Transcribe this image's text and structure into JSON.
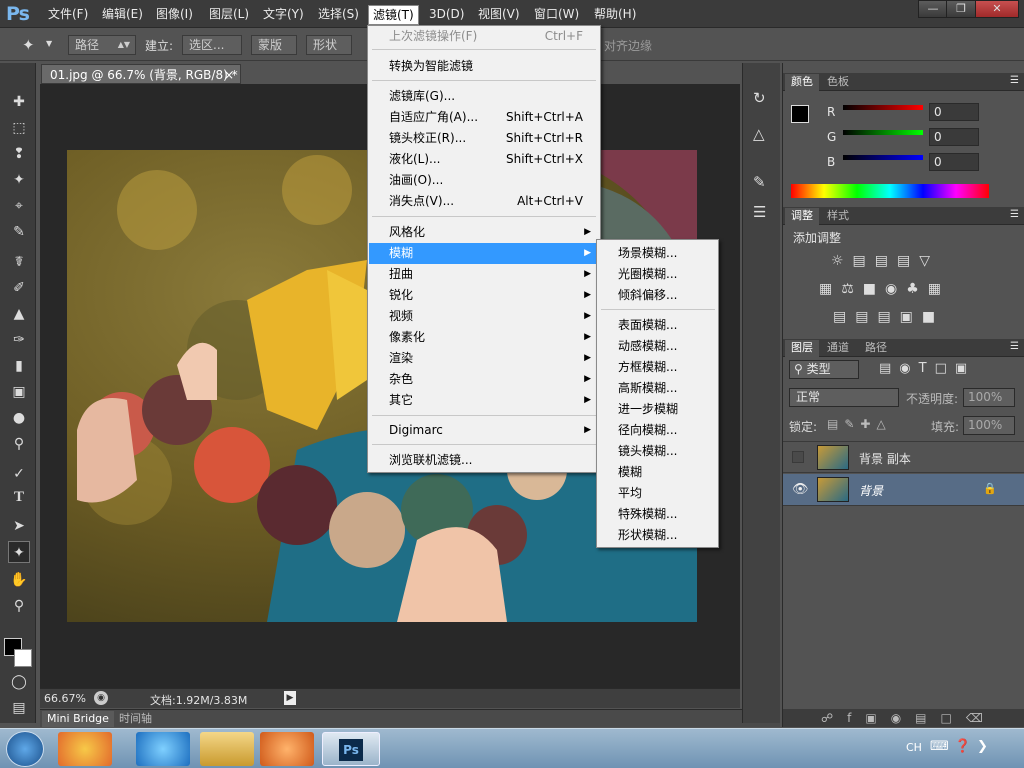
{
  "app": {
    "logo": "Ps"
  },
  "menubar": {
    "items": [
      "文件(F)",
      "编辑(E)",
      "图像(I)",
      "图层(L)",
      "文字(Y)",
      "选择(S)",
      "滤镜(T)",
      "3D(D)",
      "视图(V)",
      "窗口(W)",
      "帮助(H)"
    ],
    "active": "滤镜(T)",
    "window_controls": [
      "minimize-icon",
      "restore-icon",
      "close-icon"
    ]
  },
  "options_bar": {
    "mode_value": "路径",
    "build_label": "建立:",
    "selection_btn": "选区...",
    "mask_btn": "蒙版",
    "shape_btn": "形状",
    "align_edges": "对齐边缘"
  },
  "document": {
    "tab_title": "01.jpg @ 66.7% (背景, RGB/8) *",
    "zoom": "66.67%",
    "doc_info": "文档:1.92M/3.83M"
  },
  "bottom_tabs": [
    "Mini Bridge",
    "时间轴"
  ],
  "filter_menu": {
    "items": [
      {
        "label": "上次滤镜操作(F)",
        "shortcut": "Ctrl+F",
        "disabled": true
      },
      {
        "label": "转换为智能滤镜"
      },
      {
        "label": "滤镜库(G)..."
      },
      {
        "label": "自适应广角(A)...",
        "shortcut": "Shift+Ctrl+A"
      },
      {
        "label": "镜头校正(R)...",
        "shortcut": "Shift+Ctrl+R"
      },
      {
        "label": "液化(L)...",
        "shortcut": "Shift+Ctrl+X"
      },
      {
        "label": "油画(O)..."
      },
      {
        "label": "消失点(V)...",
        "shortcut": "Alt+Ctrl+V"
      },
      {
        "label": "风格化",
        "submenu": true
      },
      {
        "label": "模糊",
        "submenu": true,
        "highlight": true
      },
      {
        "label": "扭曲",
        "submenu": true
      },
      {
        "label": "锐化",
        "submenu": true
      },
      {
        "label": "视频",
        "submenu": true
      },
      {
        "label": "像素化",
        "submenu": true
      },
      {
        "label": "渲染",
        "submenu": true
      },
      {
        "label": "杂色",
        "submenu": true
      },
      {
        "label": "其它",
        "submenu": true
      },
      {
        "label": "Digimarc",
        "submenu": true
      },
      {
        "label": "浏览联机滤镜..."
      }
    ]
  },
  "blur_submenu": {
    "items": [
      "场景模糊...",
      "光圈模糊...",
      "倾斜偏移...",
      "表面模糊...",
      "动感模糊...",
      "方框模糊...",
      "高斯模糊...",
      "进一步模糊",
      "径向模糊...",
      "镜头模糊...",
      "模糊",
      "平均",
      "特殊模糊...",
      "形状模糊..."
    ]
  },
  "color_panel": {
    "tabs": [
      "颜色",
      "色板"
    ],
    "channels": [
      {
        "name": "R",
        "value": "0"
      },
      {
        "name": "G",
        "value": "0"
      },
      {
        "name": "B",
        "value": "0"
      }
    ]
  },
  "adjust_panel": {
    "tabs": [
      "调整",
      "样式"
    ],
    "title": "添加调整"
  },
  "layers_panel": {
    "tabs": [
      "图层",
      "通道",
      "路径"
    ],
    "filter_kind": "类型",
    "blend_mode": "正常",
    "opacity_label": "不透明度:",
    "opacity_value": "100%",
    "lock_label": "锁定:",
    "fill_label": "填充:",
    "fill_value": "100%",
    "layers": [
      {
        "name": "背景 副本",
        "visible": false,
        "selected": false,
        "locked": false
      },
      {
        "name": "背景",
        "visible": true,
        "selected": true,
        "locked": true
      }
    ]
  },
  "taskbar": {
    "tray_text": "CH"
  },
  "colors": {
    "ui_dark": "#535353",
    "menu_bg": "#f1f1f1",
    "menu_highlight": "#3399ff",
    "ps_blue": "#7ab7ee"
  }
}
